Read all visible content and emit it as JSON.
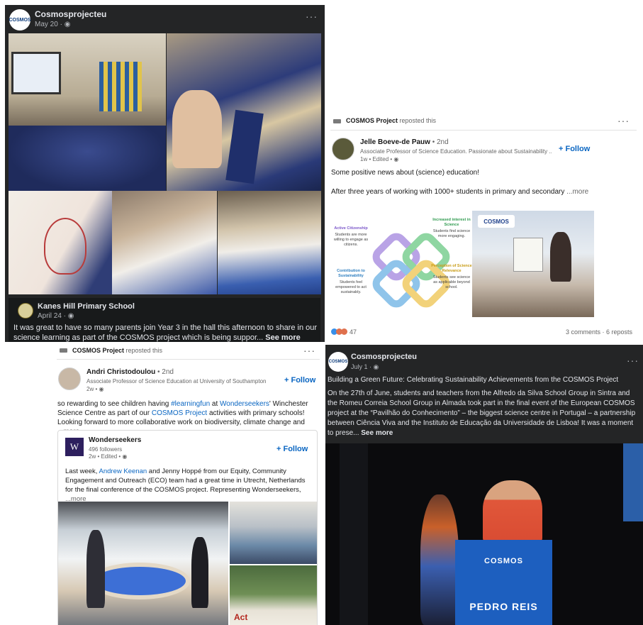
{
  "fb_post_top": {
    "page_name": "Cosmosprojecteu",
    "avatar_text": "COSMOS",
    "date": "May 20 · ",
    "globe_icon": "globe-icon",
    "more_icon": "···",
    "comment": {
      "author": "Kanes Hill Primary School",
      "date": "April 24 · ",
      "text": "It was great to have so many parents join Year 3 in the hall this afternoon to share in our science learning as part of the COSMOS project which is being suppor...",
      "see_more": "See more"
    }
  },
  "li_post_top": {
    "reposter": "COSMOS Project",
    "reposted_text": "reposted this",
    "more_icon": "···",
    "author": "Jelle Boeve-de Pauw",
    "degree": " • 2nd",
    "title": "Associate Professor of Science Education. Passionate about Sustainability ...",
    "meta": "1w • Edited • ",
    "follow": "+ Follow",
    "line1": "Some positive news about (science) education!",
    "line2": "After three years of working with 1000+ students in primary and secondary",
    "more": " ...more",
    "infographic": {
      "logo": "COSMOS",
      "blocks": [
        {
          "heading": "Active Citizenship",
          "text": "Students are more willing to engage as citizens."
        },
        {
          "heading": "Increased interest in Science",
          "text": "Students find science more engaging."
        },
        {
          "heading": "Contribution to Sustainability",
          "text": "Students feel empowered to act sustainably."
        },
        {
          "heading": "Perception of Science Relevance",
          "text": "Students see science as applicable beyond school."
        }
      ]
    },
    "reactions_count": "47",
    "comments_reposts": "3 comments · 6 reposts",
    "colors": {
      "link": "#0a66c2"
    }
  },
  "li_post_bottom": {
    "reposter": "COSMOS Project",
    "reposted_text": "reposted this",
    "more_icon": "···",
    "author": "Andri Christodoulou",
    "degree": " • 2nd",
    "title": "Associate Professor of Science Education at University of Southampton",
    "meta": "2w • ",
    "follow": "+ Follow",
    "body": {
      "p1": "so rewarding to see children having ",
      "tag": "#learningfun",
      "p2": " at ",
      "org": "Wonderseekers",
      "p3": "' Winchester Science Centre as part of our ",
      "proj": "COSMOS Project",
      "p4": " activities with primary schools! Looking forward to more collaborative work on biodiversity, climate change and",
      "more": " ...more"
    },
    "card": {
      "logo": "W",
      "name": "Wonderseekers",
      "followers": "496 followers",
      "meta": "2w • Edited • ",
      "follow": "+ Follow",
      "t1": "Last week, ",
      "person": "Andrew Keenan",
      "t2": " and Jenny Hoppé from our Equity, Community Engagement and Outreach (ECO) team had a great time in Utrecht, Netherlands for the final conference of the COSMOS project. Representing Wonderseekers,",
      "more": " ...more",
      "poster_title": "Act"
    }
  },
  "fb_post_bottom": {
    "page_name": "Cosmosprojecteu",
    "avatar_text": "COSMOS",
    "date": "July 1 · ",
    "more_icon": "···",
    "headline": "Building a Green Future: Celebrating Sustainability Achievements from the COSMOS Project",
    "body": "On the 27th of June, students and teachers from the Alfredo da Silva School Group in Sintra and the Romeu Correia School Group in Almada took part in the final event of the European COSMOS project at the “Pavilhão do Conhecimento” – the biggest science centre in Portugal – a partnership between Ciência Viva and the Instituto de Educação da Universidade de Lisboa! It was a moment to prese...",
    "see_more": "See more",
    "podium_logo": "COSMOS",
    "podium_name": "PEDRO REIS"
  }
}
